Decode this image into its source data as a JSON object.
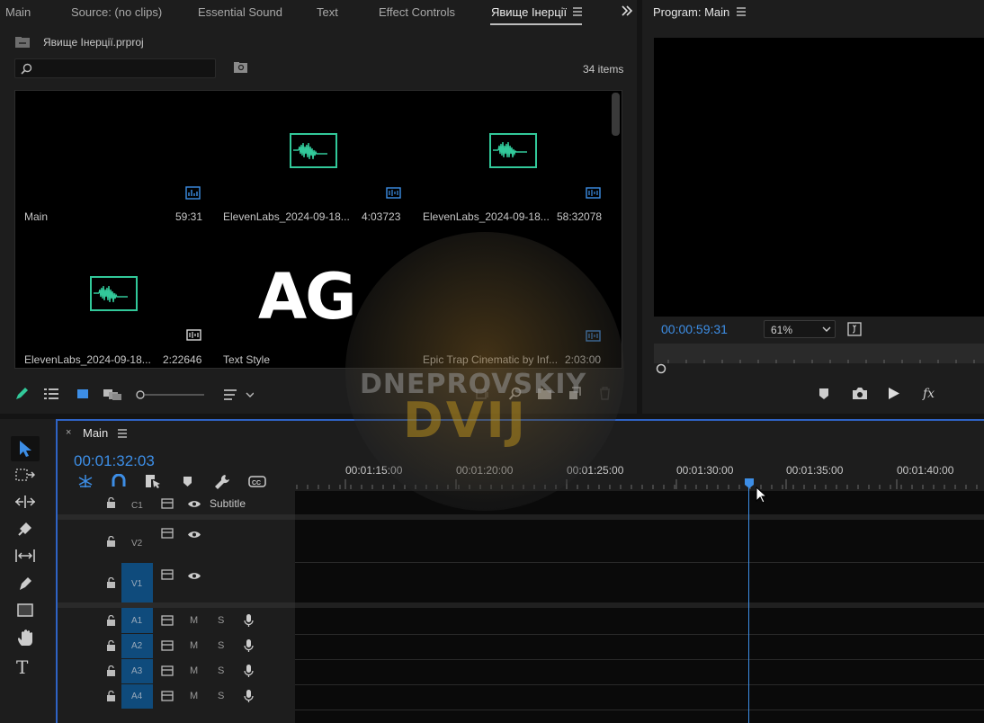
{
  "tabs": {
    "main": "Main",
    "source": "Source: (no clips)",
    "essential_sound": "Essential Sound",
    "text": "Text",
    "effect_controls": "Effect Controls",
    "project": "Явище Інерції"
  },
  "project": {
    "file_name": "Явище Інерції.prproj",
    "item_count": "34 items",
    "search_placeholder": "",
    "clips": [
      {
        "name": "Main",
        "duration": "59:31"
      },
      {
        "name": "ElevenLabs_2024-09-18...",
        "duration": "4:03723"
      },
      {
        "name": "ElevenLabs_2024-09-18...",
        "duration": "58:32078"
      },
      {
        "name": "ElevenLabs_2024-09-18...",
        "duration": "2:22646"
      },
      {
        "name": "Text Style",
        "duration": ""
      },
      {
        "name": "Epic Trap Cinematic by Inf...",
        "duration": "2:03:00"
      }
    ],
    "text_style_thumb": "AG"
  },
  "program": {
    "title": "Program: Main",
    "timecode": "00:00:59:31",
    "zoom": "61%"
  },
  "timeline": {
    "sequence_name": "Main",
    "timecode": "00:01:32:03",
    "ruler": [
      "00:01:15:00",
      "00:01:20:00",
      "00:01:25:00",
      "00:01:30:00",
      "00:01:35:00",
      "00:01:40:00"
    ],
    "tracks": {
      "c1": "C1",
      "c1_name": "Subtitle",
      "v2": "V2",
      "v1": "V1",
      "v1_src": "V1",
      "a1": "A1",
      "a2": "A2",
      "a3": "A3",
      "a4": "A4",
      "a1_src": "A1",
      "a2_src": "A2",
      "a3_src": "A3",
      "a4_src": "A4",
      "m": "M",
      "s": "S"
    }
  },
  "watermark": {
    "line1": "DNEPROVSKIY",
    "line2": "DVIJ"
  },
  "colors": {
    "accent": "#3d8ee6",
    "wave": "#32c99a",
    "track_blue": "#0f4b7c"
  }
}
